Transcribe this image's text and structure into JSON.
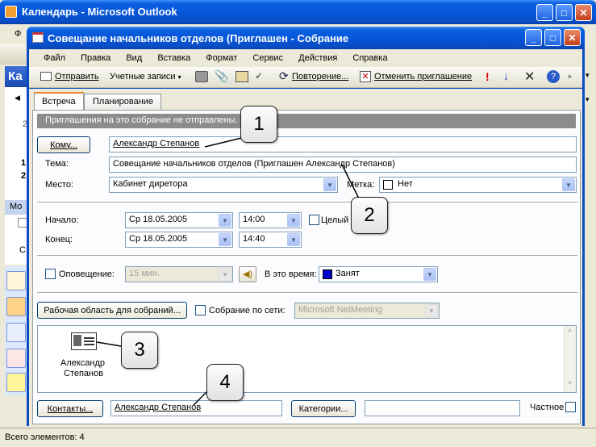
{
  "outer_window": {
    "title": "Календарь - Microsoft Outlook",
    "left_fragments": [
      "Ф",
      "Ка",
      "Мо",
      "С"
    ],
    "calendar_digits": [
      "2",
      "1",
      "2"
    ],
    "status": "Всего элементов: 4"
  },
  "dialog": {
    "title": "Совещание начальников отделов (Приглашен  - Собрание",
    "menu": [
      "Файл",
      "Правка",
      "Вид",
      "Вставка",
      "Формат",
      "Сервис",
      "Действия",
      "Справка"
    ],
    "toolbar": {
      "send": "Отправить",
      "accounts": "Учетные записи",
      "recurrence": "Повторение...",
      "cancel_invite": "Отменить приглашение"
    },
    "tabs": [
      "Встреча",
      "Планирование"
    ],
    "info_bar": "Приглашения на это собрание не отправлены.",
    "to_button": "Кому...",
    "to_value": "Александр Степанов",
    "subject_label": "Тема:",
    "subject_value": "Совещание начальников отделов (Приглашен Александр Степанов)",
    "location_label": "Место:",
    "location_value": "Кабинет диретора",
    "label_label": "Метка:",
    "label_value": "Нет",
    "start_label": "Начало:",
    "start_date": "Ср 18.05.2005",
    "start_time": "14:00",
    "allday_label": "Целый д",
    "end_label": "Конец:",
    "end_date": "Ср 18.05.2005",
    "end_time": "14:40",
    "reminder_label": "Оповещение:",
    "reminder_value": "15 мин.",
    "showas_label": "В это время:",
    "showas_value": "Занят",
    "workspace_button": "Рабочая область для собраний...",
    "online_label": "Собрание по сети:",
    "online_value": "Microsoft NetMeeting",
    "attachment_name_line1": "Александр",
    "attachment_name_line2": "Степанов",
    "contacts_button": "Контакты...",
    "contacts_value": "Александр Степанов",
    "categories_button": "Категории...",
    "categories_value": "",
    "private_label": "Частное"
  },
  "callouts": [
    "1",
    "2",
    "3",
    "4"
  ],
  "colors": {
    "titlebar": "#0654d6",
    "info_bar": "#8c8c8c",
    "busy": "#0000cc"
  }
}
